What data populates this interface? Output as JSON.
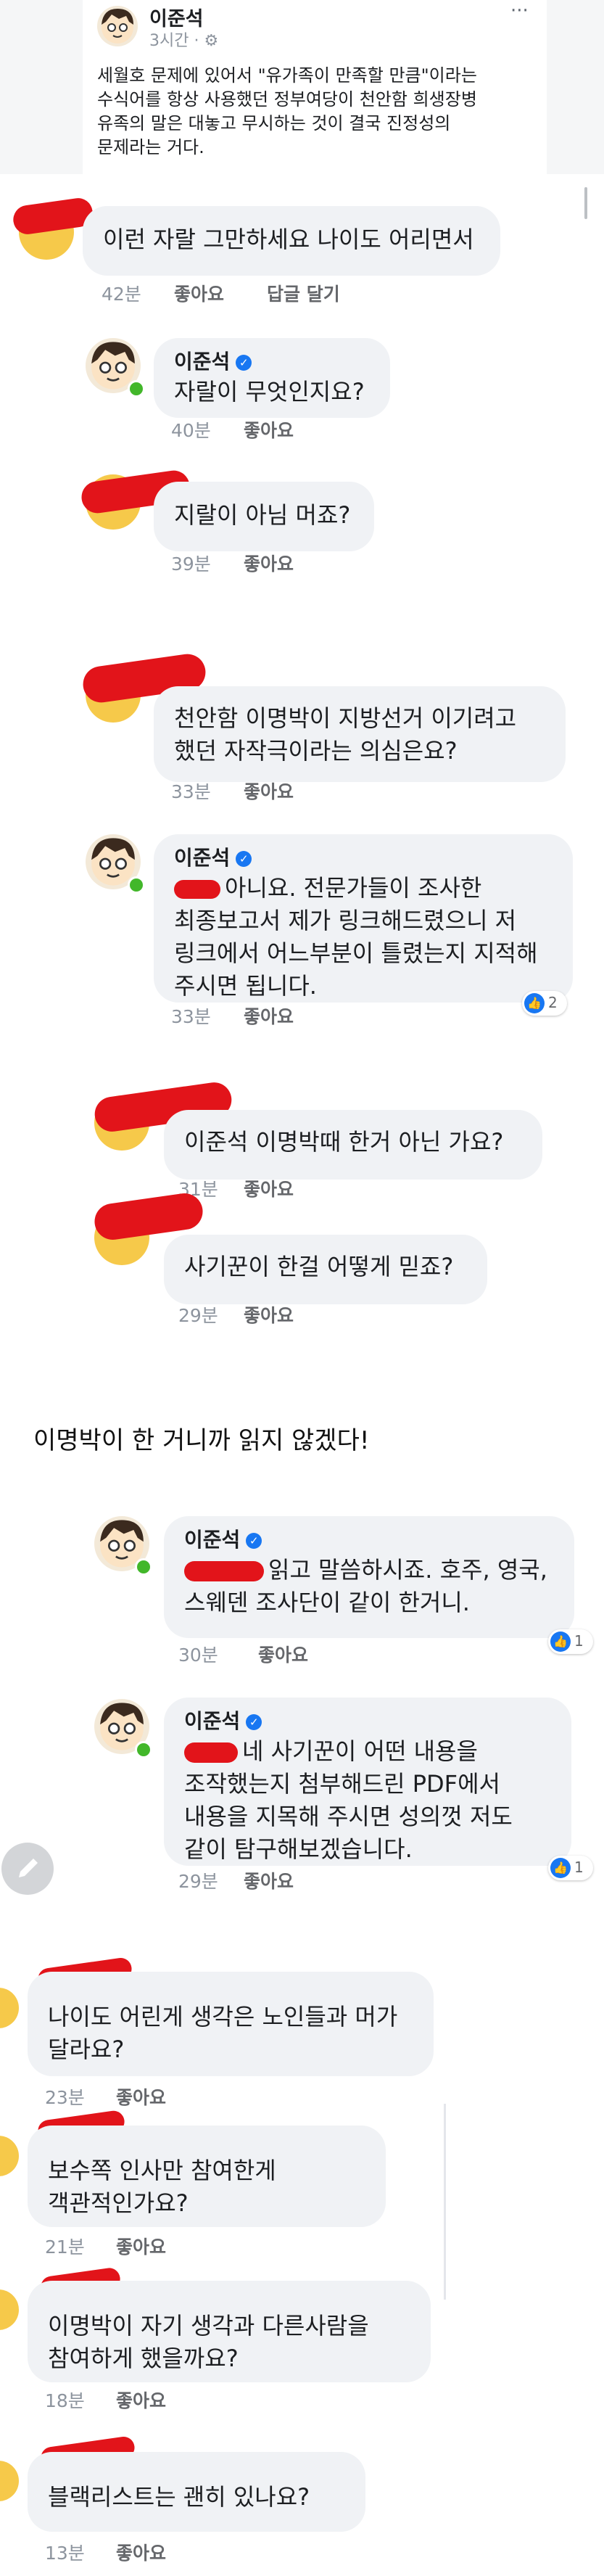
{
  "post": {
    "author": "이준석",
    "time": "3시간 · ⚙",
    "menu": "···",
    "lines": [
      "세월호 문제에 있어서 \"유가족이 만족할 만큼\"이라는",
      "수식어를 항상 사용했던 정부여당이 천안함 희생장병",
      "유족의 말은 대놓고 무시하는 것이 결국 진정성의",
      "문제라는 거다."
    ]
  },
  "actions": {
    "like": "좋아요",
    "reply": "답글 달기"
  },
  "comments": [
    {
      "name": "",
      "lines": [
        "이런 자랄 그만하세요 나이도 어리면서"
      ],
      "time": "42분",
      "like": "좋아요",
      "reply": "답글 달기"
    },
    {
      "name": "이준석",
      "lines": [
        "자랄이 무엇인지요?"
      ],
      "time": "40분",
      "like": "좋아요"
    },
    {
      "name": "",
      "lines": [
        "지랄이 아님 머죠?"
      ],
      "time": "39분",
      "like": "좋아요"
    },
    {
      "name": "",
      "lines": [
        "천안함 이명박이 지방선거 이기려고",
        "했던 자작극이라는 의심은요?"
      ],
      "time": "33분",
      "like": "좋아요"
    },
    {
      "name": "이준석",
      "lines": [
        "아니요. 전문가들이 조사한",
        "최종보고서 제가 링크해드렸으니 저",
        "링크에서 어느부분이 틀렸는지 지적해",
        "주시면 됩니다."
      ],
      "time": "33분",
      "like": "좋아요",
      "reactions": "2"
    },
    {
      "name": "",
      "lines": [
        "이준석 이명박때 한거 아닌 가요?"
      ],
      "time": "31분",
      "like": "좋아요"
    },
    {
      "name": "",
      "lines": [
        "사기꾼이 한걸 어떻게 믿죠?"
      ],
      "time": "29분",
      "like": "좋아요"
    }
  ],
  "caption": "이명박이 한 거니까 읽지 않겠다!",
  "comments2": [
    {
      "name": "이준석",
      "lines": [
        "읽고 말씀하시죠.  호주, 영국,",
        "스웨덴 조사단이 같이 한거니."
      ],
      "time": "30분",
      "like": "좋아요",
      "reactions": "1"
    },
    {
      "name": "이준석",
      "lines": [
        "네 사기꾼이 어떤 내용을",
        "조작했는지 첨부해드린 PDF에서",
        "내용을 지목해 주시면 성의껏 저도",
        "같이 탐구해보겠습니다."
      ],
      "time": "29분",
      "like": "좋아요",
      "reactions": "1"
    }
  ],
  "replies": [
    {
      "lines": [
        "나이도 어린게 생각은 노인들과 머가",
        "달라요?"
      ],
      "time": "23분",
      "like": "좋아요"
    },
    {
      "lines": [
        "보수쪽 인사만 참여한게",
        "객관적인가요?"
      ],
      "time": "21분",
      "like": "좋아요"
    },
    {
      "lines": [
        "이명박이 자기 생각과 다른사람을",
        "참여하게 했을까요?"
      ],
      "time": "18분",
      "like": "좋아요"
    },
    {
      "lines": [
        "블랙리스트는 괜히 있나요?"
      ],
      "time": "13분",
      "like": "좋아요"
    }
  ],
  "colors": {
    "redact": "#e2141a",
    "bubble": "#f0f2f5",
    "meta": "#8d949e",
    "verified": "#1877f2",
    "online": "#42b72a"
  },
  "icons": [
    "gear-icon",
    "more-icon",
    "verified-icon",
    "thumbs-up-icon",
    "pencil-icon"
  ]
}
